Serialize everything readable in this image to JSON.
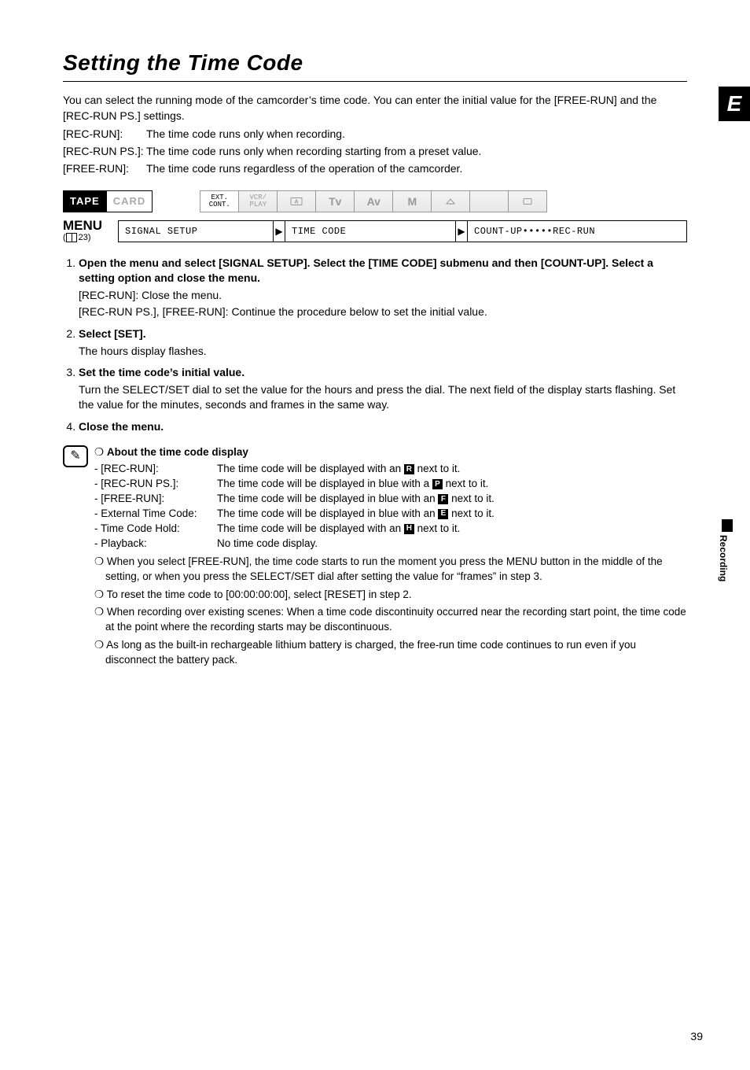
{
  "title": "Setting the Time Code",
  "side_tab": "E",
  "side_section": "Recording",
  "intro": {
    "p1": "You can select the running mode of the camcorder’s time code. You can enter the initial value for the [FREE-RUN] and the [REC-RUN PS.] settings.",
    "rows": [
      {
        "k": "[REC-RUN]:",
        "v": "The time code runs only when recording."
      },
      {
        "k": "[REC-RUN PS.]:",
        "v": "The time code runs only when recording starting from a preset value."
      },
      {
        "k": "[FREE-RUN]:",
        "v": "The time code runs regardless of the operation of the camcorder."
      }
    ]
  },
  "mode_row": {
    "tape": "TAPE",
    "card": "CARD",
    "ext": "EXT. CONT.",
    "vcr": "VCR/ PLAY",
    "a": "A",
    "tv": "Tv",
    "av": "Av",
    "m": "M"
  },
  "menu": {
    "label": "MENU",
    "ref_page": "23",
    "seg1": "SIGNAL SETUP",
    "seg2": "TIME CODE",
    "seg3": "COUNT-UP•••••REC-RUN"
  },
  "steps": [
    {
      "title": "Open the menu and select [SIGNAL SETUP]. Select the [TIME CODE] submenu and then [COUNT-UP]. Select a setting option and close the menu.",
      "body1": "[REC-RUN]:  Close the menu.",
      "body2": "[REC-RUN PS.], [FREE-RUN]:  Continue the procedure below to set the initial value."
    },
    {
      "title": "Select [SET].",
      "body1": "The hours display flashes."
    },
    {
      "title": "Set the time code’s initial value.",
      "body1": "Turn the SELECT/SET dial to set the value for the hours and press the dial. The next field of the display starts flashing. Set the value for the minutes, seconds and frames in the same way."
    },
    {
      "title": "Close the menu."
    }
  ],
  "notes": {
    "head": "About the time code display",
    "rows": [
      {
        "k": "- [REC-RUN]:",
        "badge": "R",
        "pre": "The time code will be displayed with an ",
        "post": " next to it."
      },
      {
        "k": "- [REC-RUN PS.]:",
        "badge": "P",
        "pre": "The time code will be displayed in blue with a ",
        "post": " next to it."
      },
      {
        "k": "- [FREE-RUN]:",
        "badge": "F",
        "pre": "The time code will be displayed in blue with an ",
        "post": " next to it."
      },
      {
        "k": "- External Time Code:",
        "badge": "E",
        "pre": "The time code will be displayed in blue with an ",
        "post": " next to it."
      },
      {
        "k": "- Time Code Hold:",
        "badge": "H",
        "pre": "The time code will be displayed with an ",
        "post": " next to it."
      },
      {
        "k": "- Playback:",
        "badge": "",
        "pre": "No time code display.",
        "post": ""
      }
    ],
    "bullets": [
      "When you select [FREE-RUN], the time code starts to run the moment you press the MENU button in the middle of the setting, or when you press the SELECT/SET dial after setting the value for “frames” in step 3.",
      "To reset the time code to [00:00:00:00], select [RESET] in step 2.",
      "When recording over existing scenes: When a time code discontinuity occurred near the recording start point, the time code at the point where the recording starts may be discontinuous.",
      "As long as the built-in rechargeable lithium battery is charged, the free-run time code continues to run even if you disconnect the battery pack."
    ],
    "bullet_glyph": "❍"
  },
  "page_number": "39"
}
